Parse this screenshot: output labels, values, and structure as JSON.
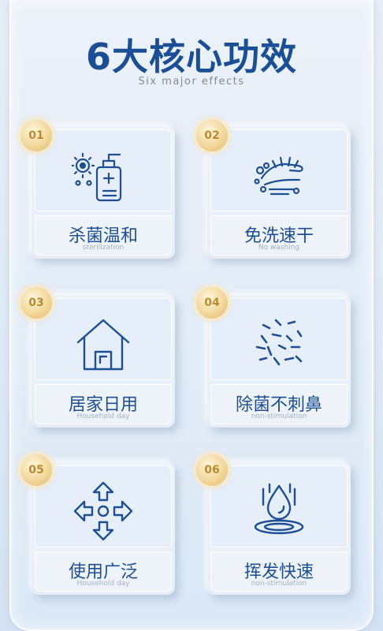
{
  "header": {
    "title": "6大核心功效",
    "subtitle": "Six major effects"
  },
  "cards": [
    {
      "num": "01",
      "name": "杀菌温和",
      "en": "sterilization",
      "icon": "sanitizer-bottle-icon"
    },
    {
      "num": "02",
      "name": "免洗速干",
      "en": "No washing",
      "icon": "washing-hands-icon"
    },
    {
      "num": "03",
      "name": "居家日用",
      "en": "Household day",
      "icon": "house-icon"
    },
    {
      "num": "04",
      "name": "除菌不刺鼻",
      "en": "non-stimulation",
      "icon": "bacteria-icon"
    },
    {
      "num": "05",
      "name": "使用广泛",
      "en": "Household day",
      "icon": "four-arrows-icon"
    },
    {
      "num": "06",
      "name": "挥发快速",
      "en": "non-stimulation",
      "icon": "water-drop-icon"
    }
  ],
  "colors": {
    "accent": "#1a4f95",
    "badge": "#e2b867"
  }
}
